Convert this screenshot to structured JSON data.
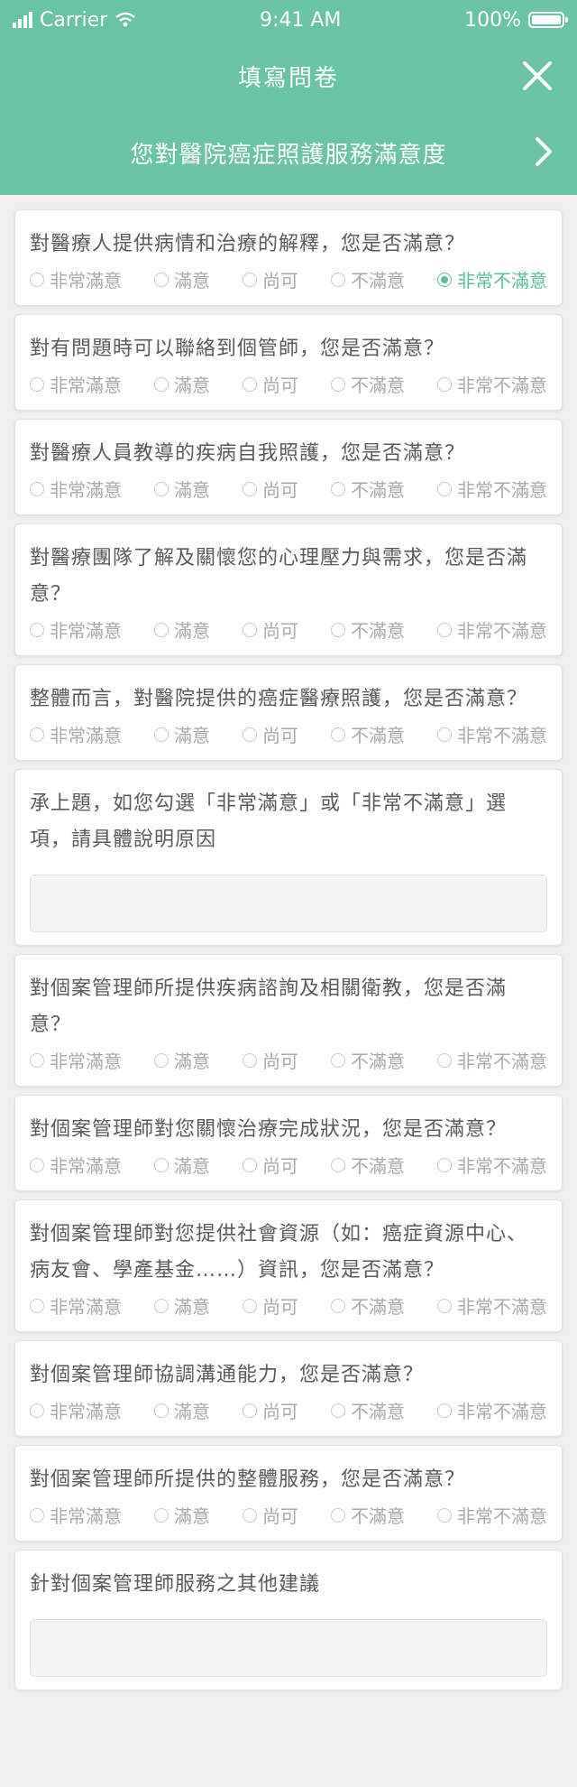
{
  "status_bar": {
    "carrier": "Carrier",
    "time": "9:41 AM",
    "battery": "100%"
  },
  "header": {
    "title": "填寫問卷",
    "subtitle": "您對醫院癌症照護服務滿意度"
  },
  "options": [
    "非常滿意",
    "滿意",
    "尚可",
    "不滿意",
    "非常不滿意"
  ],
  "questions": [
    {
      "text": "對醫療人提供病情和治療的解釋，您是否滿意？",
      "selected": "非常不滿意"
    },
    {
      "text": "對有問題時可以聯絡到個管師，您是否滿意？",
      "selected": null
    },
    {
      "text": "對醫療人員教導的疾病自我照護，您是否滿意？",
      "selected": null
    },
    {
      "text": "對醫療團隊了解及關懷您的心理壓力與需求，您是否滿意？",
      "selected": null
    },
    {
      "text": "整體而言，對醫院提供的癌症醫療照護，您是否滿意？",
      "selected": null
    },
    {
      "text": "承上題，如您勾選「非常滿意」或「非常不滿意」選項，請具體說明原因",
      "value": ""
    },
    {
      "text": "對個案管理師所提供疾病諮詢及相關衛教，您是否滿意？",
      "selected": null
    },
    {
      "text": "對個案管理師對您關懷治療完成狀況，您是否滿意？",
      "selected": null
    },
    {
      "text": "對個案管理師對您提供社會資源（如：癌症資源中心、病友會、學產基金……）資訊，您是否滿意？",
      "selected": null
    },
    {
      "text": "對個案管理師協調溝通能力，您是否滿意？",
      "selected": null
    },
    {
      "text": "對個案管理師所提供的整體服務，您是否滿意？",
      "selected": null
    },
    {
      "text": "針對個案管理師服務之其他建議",
      "value": ""
    }
  ],
  "colors": {
    "header": "#6ac3a5",
    "selected": "#5cbf9a"
  }
}
